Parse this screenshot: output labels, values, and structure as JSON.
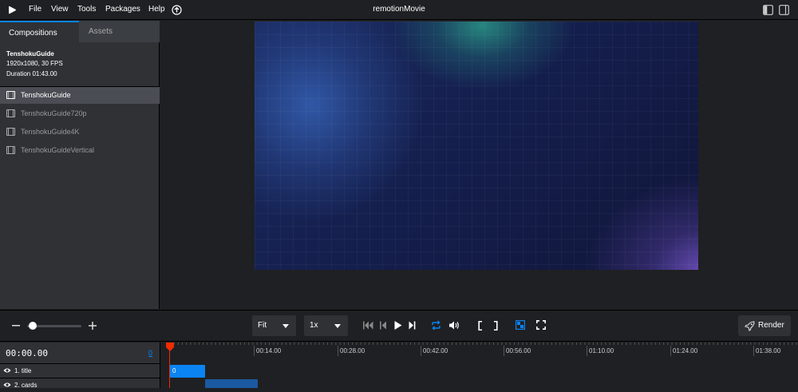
{
  "menubar": {
    "items": [
      "File",
      "View",
      "Tools",
      "Packages",
      "Help"
    ],
    "title": "remotionMovie"
  },
  "sidebar": {
    "tabs": [
      {
        "label": "Compositions",
        "active": true
      },
      {
        "label": "Assets",
        "active": false
      }
    ],
    "info": {
      "name": "TenshokuGuide",
      "specs": "1920x1080, 30 FPS",
      "duration": "Duration 01:43.00"
    },
    "compositions": [
      {
        "label": "TenshokuGuide",
        "selected": true
      },
      {
        "label": "TenshokuGuide720p",
        "selected": false
      },
      {
        "label": "TenshokuGuide4K",
        "selected": false
      },
      {
        "label": "TenshokuGuideVertical",
        "selected": false
      }
    ]
  },
  "controls": {
    "zoom_level": 0.1,
    "size_select": "Fit",
    "rate_select": "1x",
    "render_label": "Render"
  },
  "timeline": {
    "timecode": "00:00.00",
    "frame": "0",
    "ticks": [
      "00:14.00",
      "00:28.00",
      "00:42.00",
      "00:56.00",
      "01:10.00",
      "01:24.00",
      "01:38.00"
    ],
    "tracks": [
      {
        "label": "1. title",
        "clip_label": "0"
      },
      {
        "label": "2. cards",
        "clip_label": ""
      }
    ]
  },
  "colors": {
    "accent": "#0b84f3",
    "playhead": "#f02c00",
    "clip_primary": "#0b84f3",
    "clip_secondary": "#1b5aa0"
  }
}
